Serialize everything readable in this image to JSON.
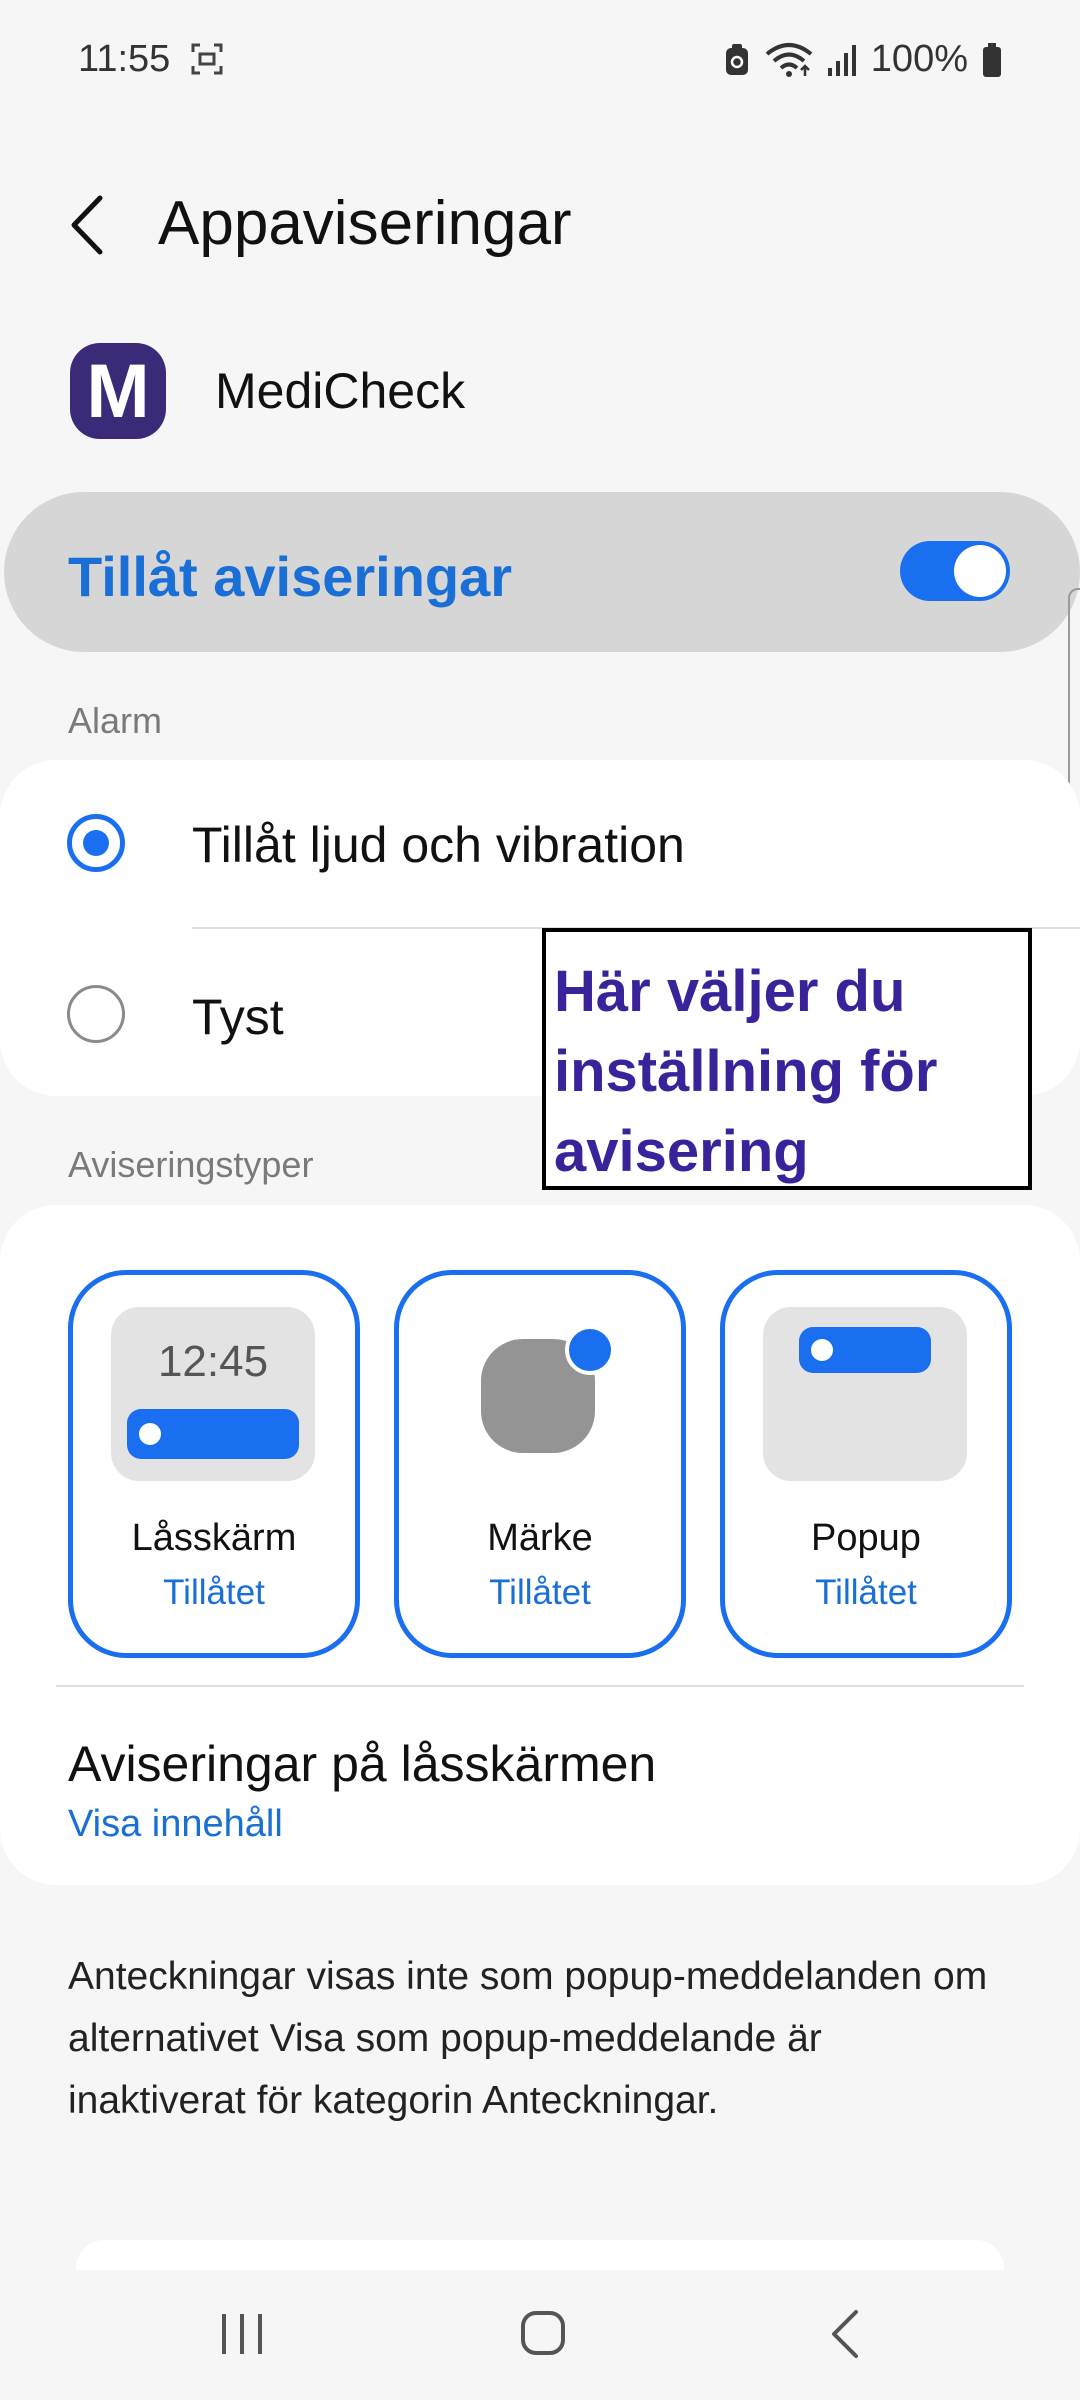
{
  "status_bar": {
    "time": "11:55",
    "battery": "100%",
    "icons": [
      "screenshot-icon",
      "data-saver-icon",
      "wifi-icon",
      "signal-icon",
      "battery-icon"
    ]
  },
  "header": {
    "title": "Appaviseringar",
    "back_icon": "back-arrow-icon"
  },
  "app": {
    "icon_letter": "M",
    "name": "MediCheck",
    "icon_color": "#3a2a78"
  },
  "allow": {
    "label": "Tillåt aviseringar",
    "enabled": true,
    "accent": "#1a6ff0"
  },
  "alarm": {
    "title": "Alarm",
    "options": [
      {
        "label": "Tillåt ljud och vibration",
        "selected": true
      },
      {
        "label": "Tyst",
        "selected": false
      }
    ]
  },
  "annotation": {
    "text": "Här väljer du inställning för avisering"
  },
  "notification_types": {
    "title": "Aviseringstyper",
    "items": [
      {
        "name": "Låsskärm",
        "status": "Tillåtet",
        "preview_time": "12:45"
      },
      {
        "name": "Märke",
        "status": "Tillåtet"
      },
      {
        "name": "Popup",
        "status": "Tillåtet"
      }
    ]
  },
  "lockscreen": {
    "title": "Aviseringar på låsskärmen",
    "value": "Visa innehåll"
  },
  "footnote": "Anteckningar visas inte som popup-meddelanden om alternativet Visa som popup-meddelande är inaktiverat för kategorin Anteckningar.",
  "nav_bar": {
    "icons": [
      "recent-apps-icon",
      "home-icon",
      "back-icon"
    ]
  }
}
